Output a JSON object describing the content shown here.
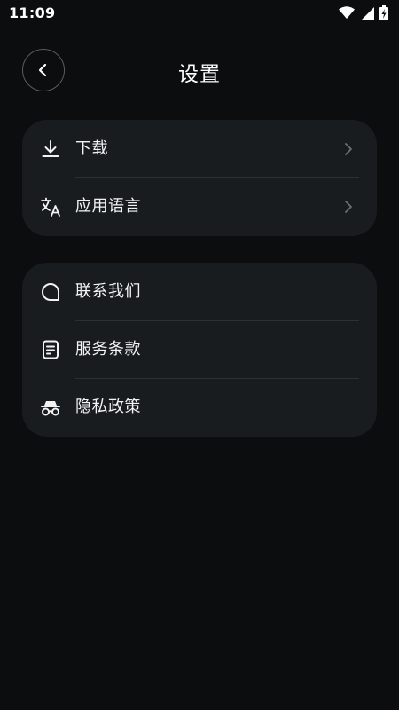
{
  "status_bar": {
    "time": "11:09",
    "icons": [
      "wifi-icon",
      "signal-icon",
      "battery-charging-icon"
    ]
  },
  "header": {
    "title": "设置",
    "back_icon": "chevron-left-icon"
  },
  "groups": [
    {
      "items": [
        {
          "label": "下载",
          "icon": "download-icon",
          "has_chevron": true
        },
        {
          "label": "应用语言",
          "icon": "translate-icon",
          "has_chevron": true
        }
      ]
    },
    {
      "items": [
        {
          "label": "联系我们",
          "icon": "chat-bubble-icon",
          "has_chevron": false
        },
        {
          "label": "服务条款",
          "icon": "document-icon",
          "has_chevron": false
        },
        {
          "label": "隐私政策",
          "icon": "incognito-icon",
          "has_chevron": false
        }
      ]
    }
  ],
  "colors": {
    "background": "#0b0d0e",
    "card": "#181c1f",
    "divider": "#2b3033",
    "text": "#f2f2f2",
    "chevron": "#6b6f72"
  }
}
